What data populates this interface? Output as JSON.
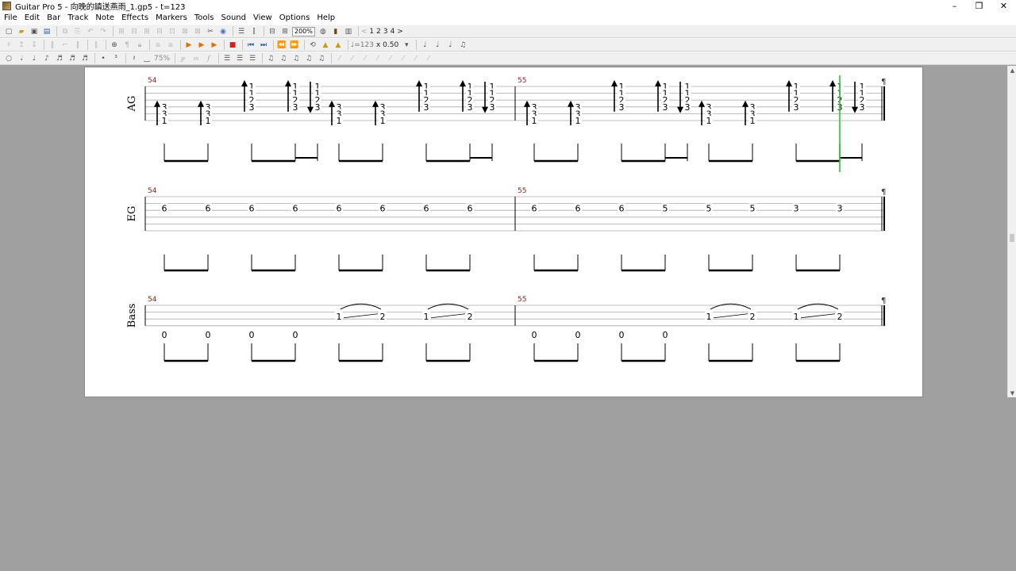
{
  "window": {
    "title": "Guitar Pro 5 - 向晚的鎮送燕雨_1.gp5 - t=123",
    "controls": [
      "–",
      "❐",
      "✕"
    ]
  },
  "menu": [
    "File",
    "Edit",
    "Bar",
    "Track",
    "Note",
    "Effects",
    "Markers",
    "Tools",
    "Sound",
    "View",
    "Options",
    "Help"
  ],
  "toolbar": {
    "zoom": "200%",
    "page_numbers": [
      "<",
      "1",
      "2",
      "3",
      "4",
      ">"
    ],
    "tempo_label": "♩=123",
    "speed": "x 0.50",
    "velocity_label": "75%"
  },
  "colors": {
    "bar_number": "#8b1a1a",
    "cursor": "#33cc33",
    "page_bg": "#ffffff",
    "workspace_bg": "#a0a0a0"
  },
  "score": {
    "tracks": [
      {
        "name": "AG",
        "bar_numbers": [
          "54",
          "55"
        ],
        "beats": [
          {
            "notes": [
              "3",
              "3",
              "1"
            ],
            "stroke": "up"
          },
          {
            "notes": [
              "3",
              "3",
              "1"
            ],
            "stroke": "up"
          },
          {
            "notes": [
              "1",
              "1",
              "2",
              "3"
            ],
            "stroke": "up"
          },
          {
            "notes": [
              "1",
              "1",
              "2",
              "3"
            ],
            "stroke": "up"
          },
          {
            "notes": [
              "1",
              "1",
              "2",
              "3"
            ],
            "stroke": "down"
          },
          {
            "notes": [
              "3",
              "3",
              "1"
            ],
            "stroke": "up"
          },
          {
            "notes": [
              "3",
              "3",
              "1"
            ],
            "stroke": "up"
          },
          {
            "notes": [
              "1",
              "1",
              "2",
              "3"
            ],
            "stroke": "up"
          },
          {
            "notes": [
              "1",
              "1",
              "2",
              "3"
            ],
            "stroke": "up"
          },
          {
            "notes": [
              "1",
              "1",
              "2",
              "3"
            ],
            "stroke": "down"
          },
          {
            "notes": [
              "3",
              "3",
              "1"
            ],
            "stroke": "up"
          },
          {
            "notes": [
              "3",
              "3",
              "1"
            ],
            "stroke": "up"
          },
          {
            "notes": [
              "1",
              "1",
              "2",
              "3"
            ],
            "stroke": "up"
          },
          {
            "notes": [
              "1",
              "1",
              "2",
              "3"
            ],
            "stroke": "up"
          },
          {
            "notes": [
              "1",
              "1",
              "2",
              "3"
            ],
            "stroke": "down"
          },
          {
            "notes": [
              "3",
              "3",
              "1"
            ],
            "stroke": "up"
          },
          {
            "notes": [
              "3",
              "3",
              "1"
            ],
            "stroke": "up"
          },
          {
            "notes": [
              "1",
              "1",
              "2",
              "3"
            ],
            "stroke": "up"
          },
          {
            "notes": [
              "1",
              "1",
              "2",
              "3"
            ],
            "stroke": "up"
          },
          {
            "notes": [
              "1",
              "1",
              "2",
              "3"
            ],
            "stroke": "down"
          }
        ]
      },
      {
        "name": "EG",
        "bar_numbers": [
          "54",
          "55"
        ],
        "notes": [
          "6",
          "6",
          "6",
          "6",
          "6",
          "6",
          "6",
          "6",
          "6",
          "6",
          "6",
          "5",
          "5",
          "5",
          "3",
          "3"
        ]
      },
      {
        "name": "Bass",
        "bar_numbers": [
          "54",
          "55"
        ],
        "notes": [
          "0",
          "0",
          "0",
          "0",
          "1",
          "2",
          "1",
          "2",
          "0",
          "0",
          "0",
          "0",
          "1",
          "2",
          "1",
          "2"
        ]
      }
    ]
  }
}
